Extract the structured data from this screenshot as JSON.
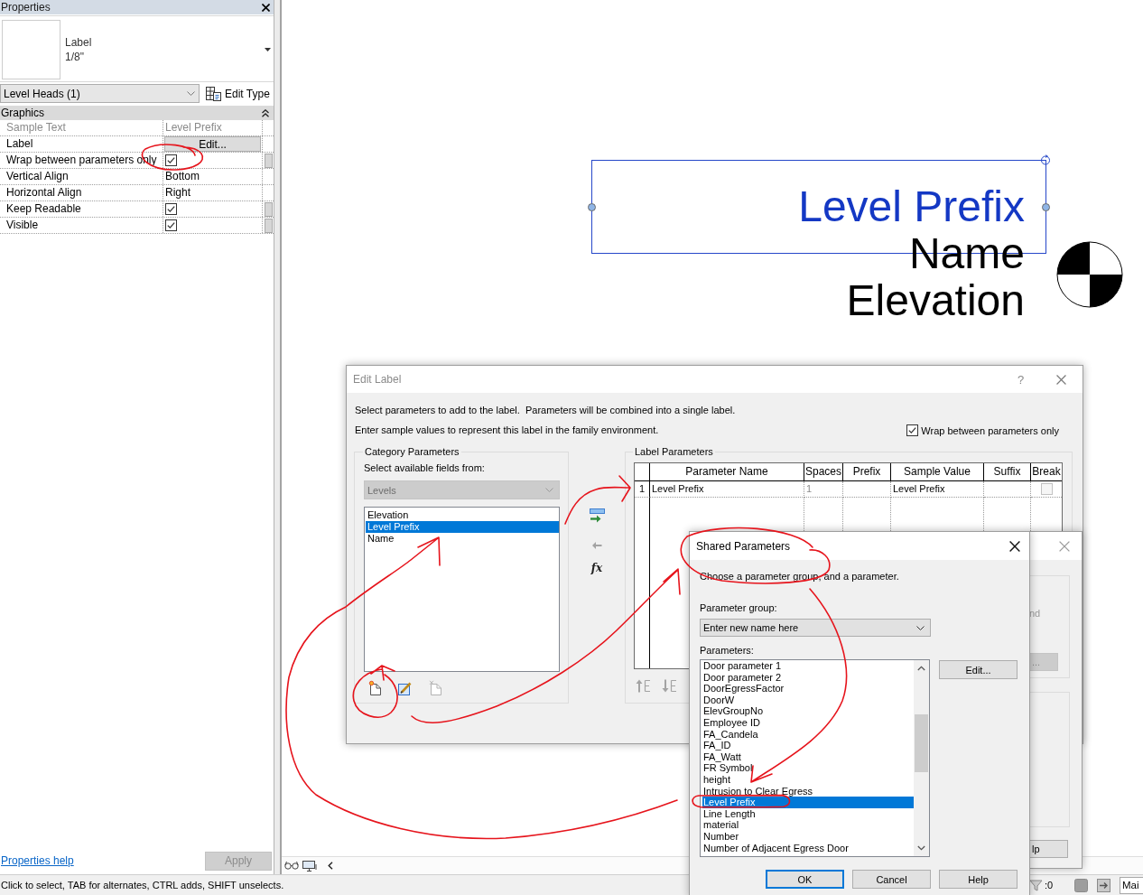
{
  "properties": {
    "title": "Properties",
    "type_selector": {
      "family": "Label",
      "type": "1/8\""
    },
    "instance_filter": "Level Heads (1)",
    "edit_type": "Edit Type",
    "section": {
      "title": "Graphics",
      "expanded": true
    },
    "rows": [
      {
        "kind": "text",
        "name": "Sample Text",
        "value": "Level Prefix",
        "disabled": true
      },
      {
        "kind": "button",
        "name": "Label",
        "value": "Edit...",
        "disabled": false
      },
      {
        "kind": "checkbox",
        "name": "Wrap between parameters only",
        "checked": true,
        "disabled": false
      },
      {
        "kind": "text",
        "name": "Vertical Align",
        "value": "Bottom",
        "disabled": false
      },
      {
        "kind": "text",
        "name": "Horizontal Align",
        "value": "Right",
        "disabled": false
      },
      {
        "kind": "checkbox",
        "name": "Keep Readable",
        "checked": true,
        "disabled": false
      },
      {
        "kind": "checkbox",
        "name": "Visible",
        "checked": true,
        "disabled": false
      }
    ],
    "help_link": "Properties help",
    "apply": {
      "label": "Apply",
      "disabled": true
    }
  },
  "canvas": {
    "label_lines": [
      {
        "text": "Level Prefix",
        "selected": true
      },
      {
        "text": "Name",
        "selected": false
      },
      {
        "text": "Elevation",
        "selected": false
      }
    ]
  },
  "edit_label_dialog": {
    "title": "Edit Label",
    "help": "?",
    "instructions": [
      "Select parameters to add to the label.  Parameters will be combined into a single label.",
      "Enter sample values to represent this label in the family environment."
    ],
    "wrap_option": {
      "label": "Wrap between parameters only",
      "checked": true
    },
    "category_parameters": {
      "title": "Category Parameters",
      "prompt": "Select available fields from:",
      "category": {
        "value": "Levels",
        "disabled": true
      },
      "fields": [
        {
          "label": "Elevation",
          "selected": false
        },
        {
          "label": "Level Prefix",
          "selected": true
        },
        {
          "label": "Name",
          "selected": false
        }
      ]
    },
    "formula": "fx",
    "label_parameters": {
      "title": "Label Parameters",
      "columns": [
        "Parameter Name",
        "Spaces",
        "Prefix",
        "Sample Value",
        "Suffix",
        "Break"
      ],
      "rows": [
        {
          "number": "1",
          "parameter_name": "Level Prefix",
          "spaces": "1",
          "sample_value": "Level Prefix",
          "break": false
        }
      ]
    }
  },
  "background_dialog": {
    "text": "nd",
    "buttons": [
      {
        "label": "...",
        "disabled": true
      },
      {
        "label": "lp",
        "disabled": false
      }
    ]
  },
  "shared_parameters_dialog": {
    "title": "Shared Parameters",
    "instruction": "Choose a parameter group, and a parameter.",
    "group_label": "Parameter group:",
    "group_value": "Enter new name here",
    "parameters_label": "Parameters:",
    "parameters": [
      {
        "name": "Door parameter 1",
        "selected": false
      },
      {
        "name": "Door parameter 2",
        "selected": false
      },
      {
        "name": "DoorEgressFactor",
        "selected": false
      },
      {
        "name": "DoorW",
        "selected": false
      },
      {
        "name": "ElevGroupNo",
        "selected": false
      },
      {
        "name": "Employee ID",
        "selected": false
      },
      {
        "name": "FA_Candela",
        "selected": false
      },
      {
        "name": "FA_ID",
        "selected": false
      },
      {
        "name": "FA_Watt",
        "selected": false
      },
      {
        "name": "FR Symbol",
        "selected": false
      },
      {
        "name": "height",
        "selected": false
      },
      {
        "name": "Intrusion to Clear Egress",
        "selected": false
      },
      {
        "name": "Level Prefix",
        "selected": true
      },
      {
        "name": "Line Length",
        "selected": false
      },
      {
        "name": "material",
        "selected": false
      },
      {
        "name": "Number",
        "selected": false
      },
      {
        "name": "Number of Adjacent Egress Door",
        "selected": false
      }
    ],
    "edit_button": "Edit...",
    "buttons": [
      {
        "label": "OK",
        "default": true
      },
      {
        "label": "Cancel",
        "default": false
      },
      {
        "label": "Help",
        "default": false
      }
    ]
  },
  "status_bar": {
    "message": "Click to select, TAB for alternates, CTRL adds, SHIFT unselects.",
    "selection_count": ":0",
    "workset": "Mai"
  }
}
